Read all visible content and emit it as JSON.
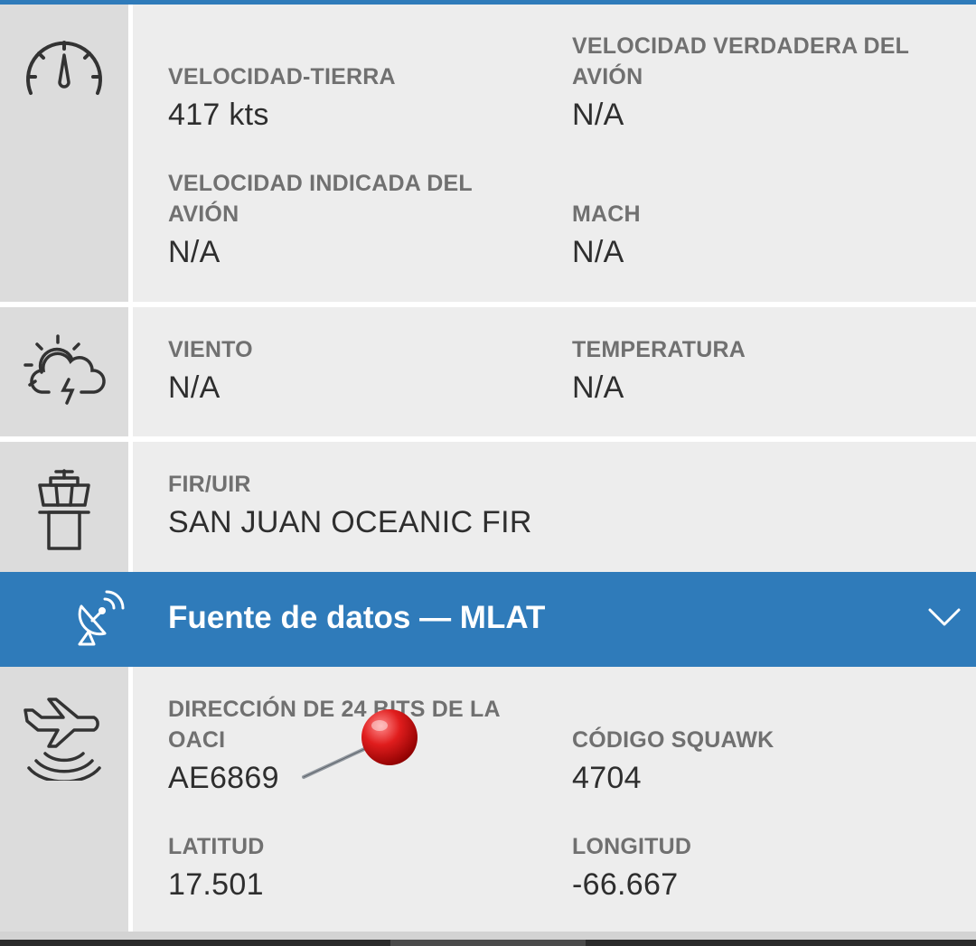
{
  "speed": {
    "icon": "speedometer-icon",
    "ground_speed_label": "VELOCIDAD-TIERRA",
    "ground_speed_value": "417 kts",
    "true_airspeed_label_line1": "VELOCIDAD VERDADERA DEL",
    "true_airspeed_label_line2": "AVIÓN",
    "true_airspeed_value": "N/A",
    "indicated_airspeed_label_line1": "VELOCIDAD INDICADA DEL",
    "indicated_airspeed_label_line2": "AVIÓN",
    "indicated_airspeed_value": "N/A",
    "mach_label": "MACH",
    "mach_value": "N/A"
  },
  "weather": {
    "icon": "weather-icon",
    "wind_label": "VIENTO",
    "wind_value": "N/A",
    "temperature_label": "TEMPERATURA",
    "temperature_value": "N/A"
  },
  "fir": {
    "icon": "control-tower-icon",
    "label": "FIR/UIR",
    "value": "SAN JUAN OCEANIC FIR"
  },
  "data_source": {
    "icon": "satellite-dish-icon",
    "title": "Fuente de datos — MLAT",
    "toggle_icon": "chevron-down-icon",
    "accent_color": "#2f7bba"
  },
  "transponder": {
    "icon": "aircraft-signal-icon",
    "icao_label_line1": "DIRECCIÓN DE 24 BITS DE LA",
    "icao_label_line2": "OACI",
    "icao_value": "AE6869",
    "squawk_label": "CÓDIGO SQUAWK",
    "squawk_value": "4704",
    "latitude_label": "LATITUD",
    "latitude_value": "17.501",
    "longitude_label": "LONGITUD",
    "longitude_value": "-66.667"
  },
  "overlay": {
    "icon": "red-pushpin-icon"
  }
}
